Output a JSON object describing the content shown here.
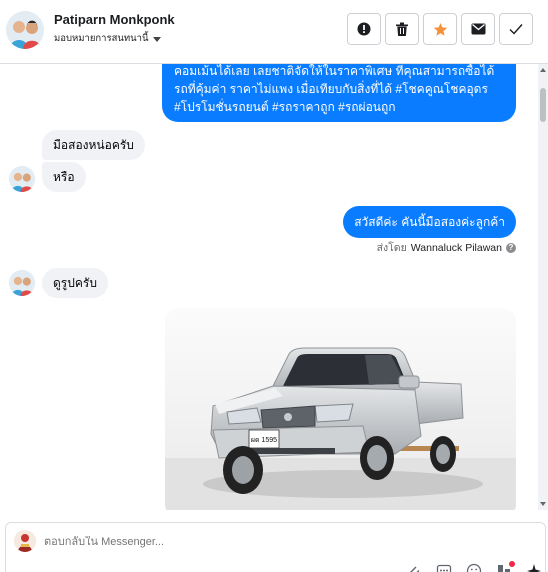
{
  "header": {
    "contact_name": "Patiparn Monkponk",
    "assign_label": "มอบหมายการสนทนานี้",
    "actions": [
      {
        "name": "mark-spam-button",
        "icon": "exclamation-icon"
      },
      {
        "name": "delete-button",
        "icon": "trash-icon"
      },
      {
        "name": "star-button",
        "icon": "star-icon",
        "color": "#f7923a"
      },
      {
        "name": "mark-unread-button",
        "icon": "envelope-icon"
      },
      {
        "name": "mark-done-button",
        "icon": "check-icon"
      }
    ]
  },
  "messages": {
    "outgoing_big": {
      "line1": "คอมเม้นได้เลย เลยชาติจัดให้ในราคาพิเศษ ที่คุณสามารถซื้อได้",
      "line2": "รถที่คุ้มค่า ราคาไม่แพง เมื่อเทียบกับสิ่งที่ได้ #โชคคูณโชคอุดร",
      "line3": "#โปรโมชั่นรถยนต์ #รถราคาถูก #รถผ่อนถูก"
    },
    "in_1": "มือสองหน่อครับ",
    "in_2": "หรือ",
    "out_hello": "สวัสดีค่ะ คันนี้มือสองค่ะลูกค้า",
    "sent_by_prefix": "ส่งโดย",
    "sent_by_name": "Wannaluck Pilawan",
    "in_3": "ดูรูปครับ"
  },
  "photo": {
    "plate_text": "ผด 1595"
  },
  "composer": {
    "placeholder": "ตอบกลับใน Messenger..."
  },
  "colors": {
    "accent": "#0a7cff",
    "incoming_bg": "#f0f2f5",
    "star": "#f7923a"
  }
}
